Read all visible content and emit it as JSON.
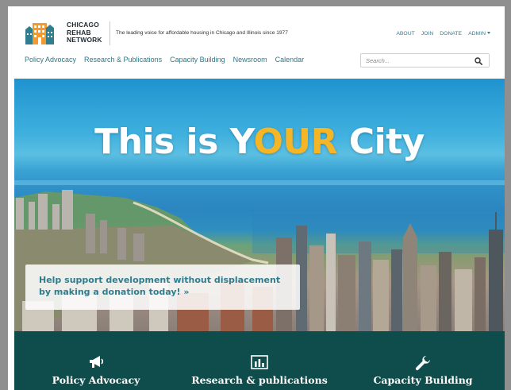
{
  "org": {
    "name_lines": [
      "CHICAGO",
      "REHAB",
      "NETWORK"
    ],
    "tagline": "The leading voice for affordable housing in Chicago and Illinois since 1977"
  },
  "utility_nav": [
    "ABOUT",
    "JOIN",
    "DONATE",
    "ADMIN"
  ],
  "main_nav": [
    "Policy Advocacy",
    "Research & Publications",
    "Capacity Building",
    "Newsroom",
    "Calendar"
  ],
  "search": {
    "placeholder": "Search..."
  },
  "hero": {
    "title_pre": "This is Y",
    "title_accent": "OUR",
    "title_post": " City",
    "cta_line1": "Help support development without displacement",
    "cta_line2": "by making a donation today! »"
  },
  "features": [
    {
      "label": "Policy Advocacy",
      "icon": "megaphone-icon"
    },
    {
      "label": "Research & publications",
      "icon": "bar-chart-icon"
    },
    {
      "label": "Capacity Building",
      "icon": "wrench-icon"
    }
  ],
  "colors": {
    "brand_teal": "#2a7a8a",
    "accent_gold": "#f4b526",
    "feature_bar": "#0f4d4d",
    "logo_orange": "#f29a2e",
    "logo_teal": "#2f7d8f"
  }
}
